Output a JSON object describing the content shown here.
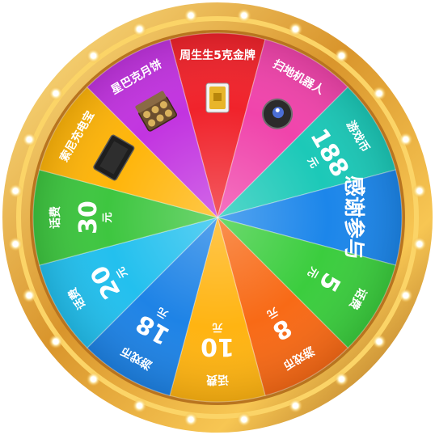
{
  "wheel": {
    "colors": {
      "rim_gold": "#e6a93a",
      "rim_dark": "#a9651b",
      "rim_light": "#ffe07a",
      "bulb": "#fff6c9"
    },
    "segments": [
      {
        "name": "周生生5克金牌",
        "value": "",
        "unit": "",
        "color": "#f0232b",
        "icon": "gold-bar-icon"
      },
      {
        "name": "扫地机器人",
        "value": "",
        "unit": "",
        "color": "#f044ab",
        "icon": "robot-vacuum-icon"
      },
      {
        "name": "游戏币",
        "value": "188",
        "unit": "元",
        "color": "#1cc9b8",
        "icon": ""
      },
      {
        "name": "",
        "value": "感谢参与",
        "unit": "",
        "color": "#1c86ea",
        "icon": ""
      },
      {
        "name": "话费",
        "value": "5",
        "unit": "元",
        "color": "#3bcd3e",
        "icon": ""
      },
      {
        "name": "游戏币",
        "value": "8",
        "unit": "元",
        "color": "#f86a16",
        "icon": ""
      },
      {
        "name": "话费",
        "value": "10",
        "unit": "元",
        "color": "#ffb412",
        "icon": ""
      },
      {
        "name": "游戏币",
        "value": "18",
        "unit": "元",
        "color": "#1e83e6",
        "icon": ""
      },
      {
        "name": "话费",
        "value": "20",
        "unit": "元",
        "color": "#23c0ee",
        "icon": ""
      },
      {
        "name": "话费",
        "value": "30",
        "unit": "元",
        "color": "#3ec640",
        "icon": ""
      },
      {
        "name": "索尼充电宝",
        "value": "",
        "unit": "",
        "color": "#ffb50a",
        "icon": "power-bank-icon"
      },
      {
        "name": "星巴克月饼",
        "value": "",
        "unit": "",
        "color": "#c234e0",
        "icon": "mooncake-box-icon"
      }
    ]
  }
}
